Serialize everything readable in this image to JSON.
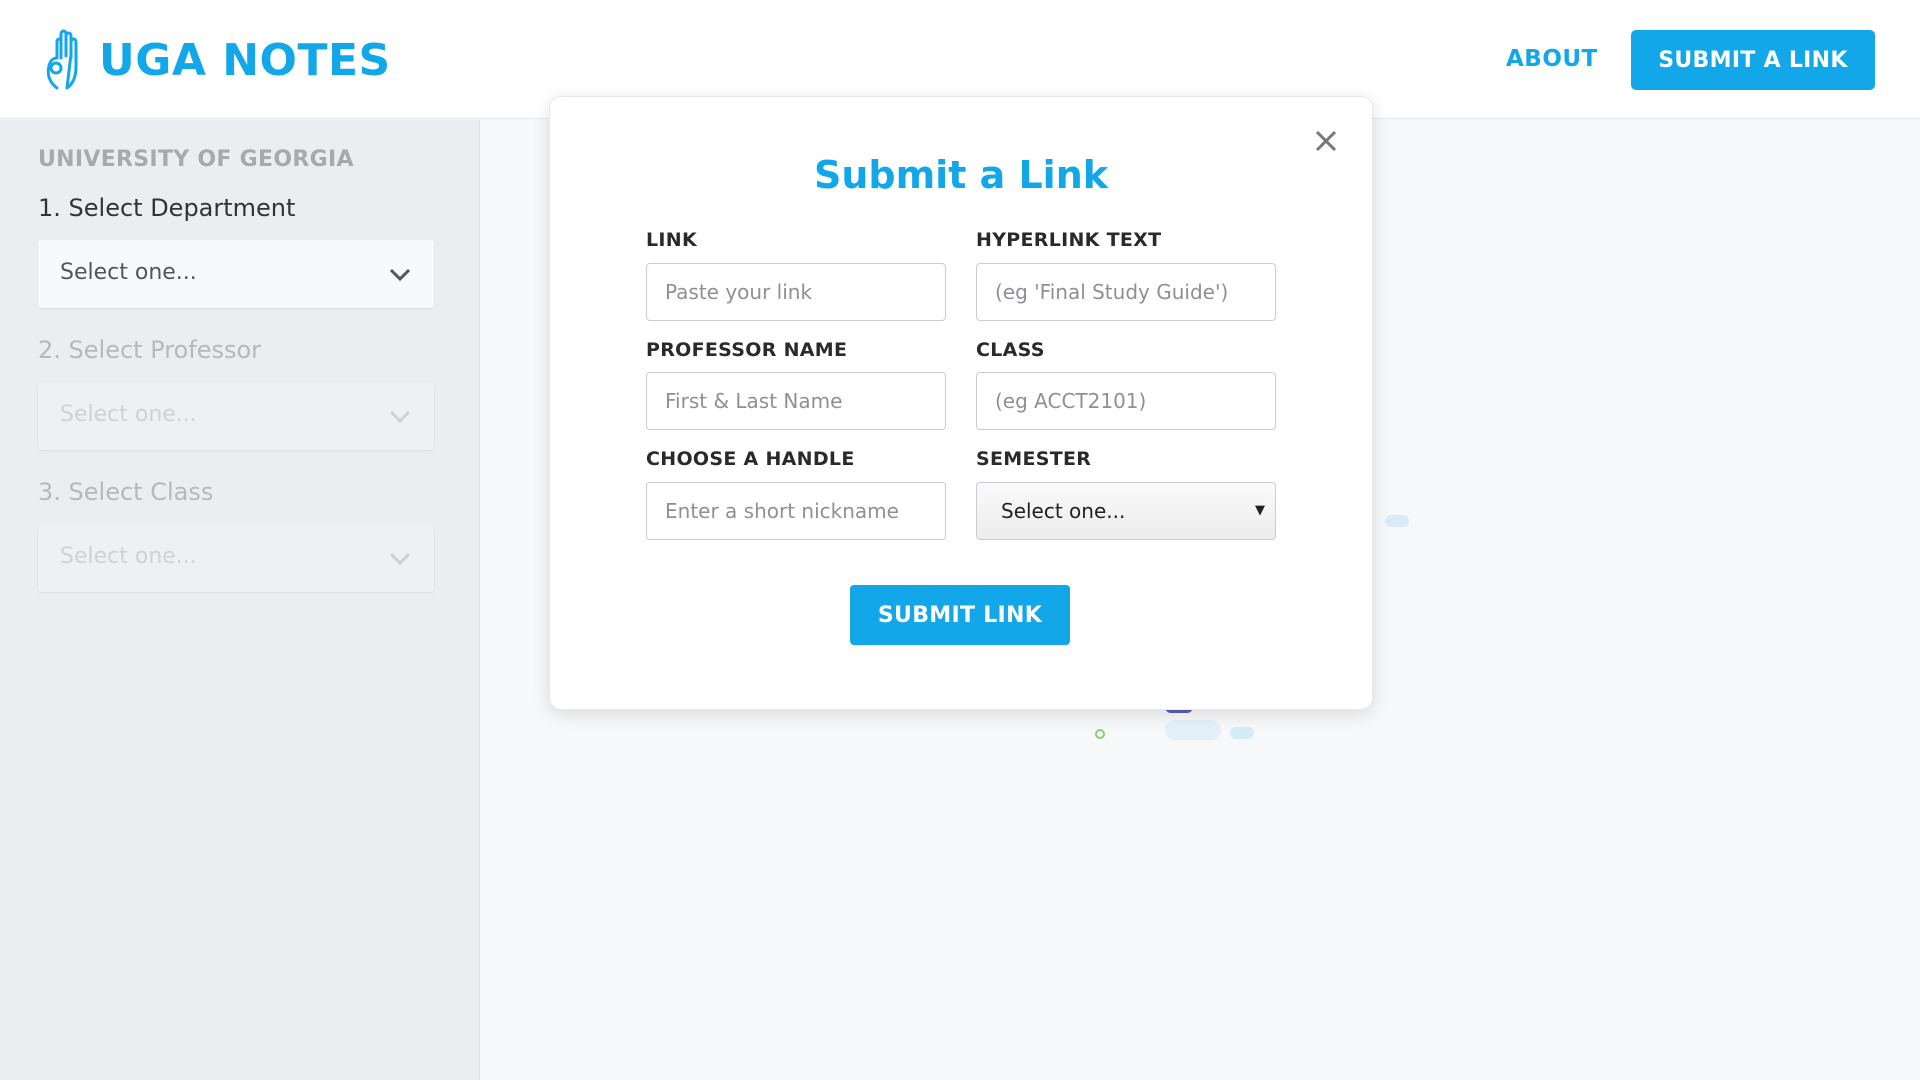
{
  "header": {
    "brand_name": "UGA NOTES",
    "brand_icon": "ok-hand-icon",
    "about_label": "ABOUT",
    "submit_link_label": "SUBMIT A LINK"
  },
  "sidebar": {
    "university": "UNIVERSITY OF GEORGIA",
    "steps": [
      {
        "label": "1. Select Department",
        "value": "Select one...",
        "enabled": true
      },
      {
        "label": "2. Select Professor",
        "value": "Select one...",
        "enabled": false
      },
      {
        "label": "3. Select Class",
        "value": "Select one...",
        "enabled": false
      }
    ]
  },
  "modal": {
    "title": "Submit a Link",
    "fields": {
      "link": {
        "label": "LINK",
        "placeholder": "Paste your link"
      },
      "hyperlink_text": {
        "label": "HYPERLINK TEXT",
        "placeholder": "(eg 'Final Study Guide')"
      },
      "professor_name": {
        "label": "PROFESSOR NAME",
        "placeholder": "First & Last Name"
      },
      "class": {
        "label": "CLASS",
        "placeholder": "(eg ACCT2101)"
      },
      "handle": {
        "label": "CHOOSE A HANDLE",
        "placeholder": "Enter a short nickname"
      },
      "semester": {
        "label": "SEMESTER",
        "value": "Select one..."
      }
    },
    "submit_label": "SUBMIT LINK"
  },
  "colors": {
    "accent": "#11a7e8",
    "sidebar_bg": "#ecedf1",
    "page_bg": "#f7f8fa"
  }
}
